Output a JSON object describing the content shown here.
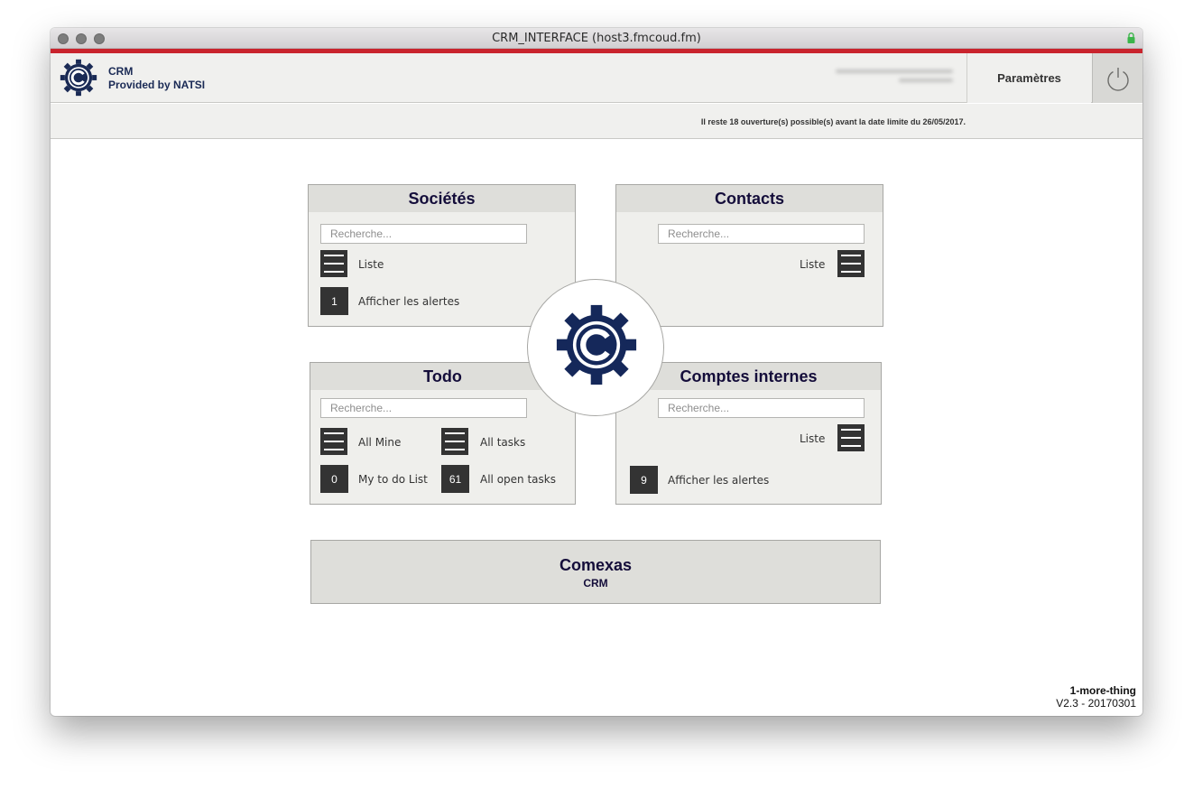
{
  "window": {
    "title": "CRM_INTERFACE (host3.fmcoud.fm)"
  },
  "header": {
    "brand_line1": "CRM",
    "brand_line2": "Provided by NATSI",
    "settings_label": "Paramètres",
    "power_icon": "power-icon"
  },
  "notice": {
    "text": "Il reste 18 ouverture(s) possible(s) avant la date limite du 26/05/2017."
  },
  "panels": {
    "societes": {
      "title": "Sociétés",
      "search_placeholder": "Recherche...",
      "list_label": "Liste",
      "alerts_count": "1",
      "alerts_label": "Afficher les alertes"
    },
    "contacts": {
      "title": "Contacts",
      "search_placeholder": "Recherche...",
      "list_label": "Liste"
    },
    "todo": {
      "title": "Todo",
      "search_placeholder": "Recherche...",
      "all_mine_label": "All Mine",
      "all_tasks_label": "All tasks",
      "my_todo_count": "0",
      "my_todo_label": "My to do List",
      "open_tasks_count": "61",
      "open_tasks_label": "All open tasks"
    },
    "comptes": {
      "title": "Comptes internes",
      "search_placeholder": "Recherche...",
      "list_label": "Liste",
      "alerts_count": "9",
      "alerts_label": "Afficher les alertes"
    }
  },
  "footer_box": {
    "title": "Comexas",
    "subtitle": "CRM"
  },
  "credits": {
    "line1": "1-more-thing",
    "line2": "V2.3 - 20170301"
  },
  "colors": {
    "accent_red": "#c9242d",
    "navy": "#1a2a55",
    "dark_button": "#333333",
    "panel_bg": "#efefec",
    "panel_head": "#dededa"
  }
}
